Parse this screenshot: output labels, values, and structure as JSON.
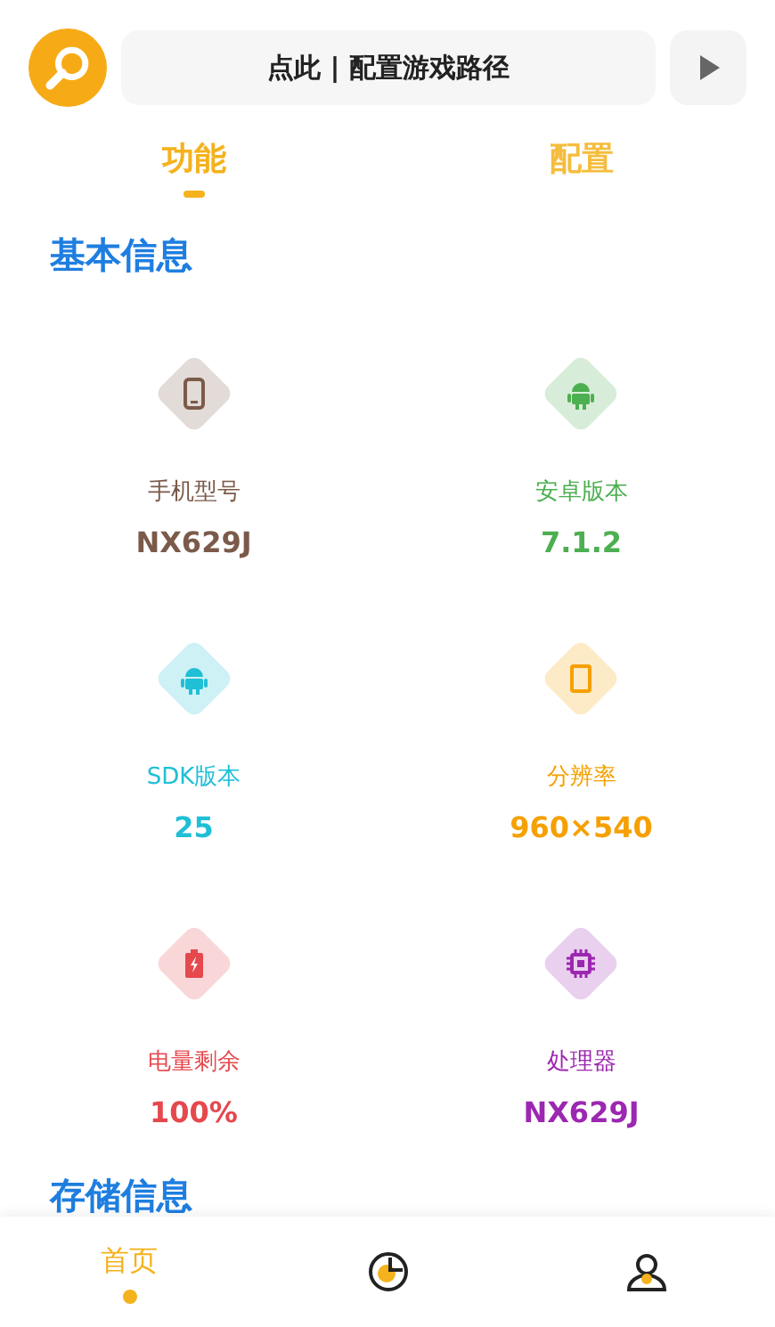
{
  "header": {
    "path_button": "点此 | 配置游戏路径"
  },
  "tabs": [
    {
      "label": "功能",
      "selected": true
    },
    {
      "label": "配置",
      "selected": false
    }
  ],
  "sections": [
    {
      "title": "基本信息",
      "items": [
        {
          "label": "手机型号",
          "value": "NX629J",
          "color": "#7b5a4a"
        },
        {
          "label": "安卓版本",
          "value": "7.1.2",
          "color": "#4caf50"
        },
        {
          "label": "SDK版本",
          "value": "25",
          "color": "#1fbfd6"
        },
        {
          "label": "分辨率",
          "value": "960×540",
          "color": "#f5a000"
        },
        {
          "label": "电量剩余",
          "value": "100%",
          "color": "#e5484d"
        },
        {
          "label": "处理器",
          "value": "NX629J",
          "color": "#9c27b0"
        }
      ]
    },
    {
      "title": "存储信息"
    }
  ],
  "bottom_nav": [
    {
      "label": "首页",
      "selected": true
    },
    {
      "selected": false
    },
    {
      "selected": false
    }
  ]
}
